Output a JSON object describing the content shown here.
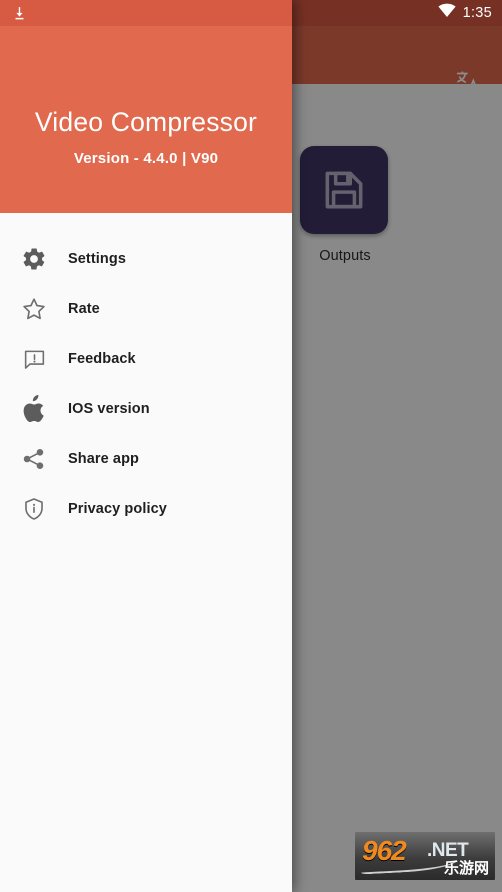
{
  "status_bar": {
    "time": "1:35",
    "download_icon": "download-icon",
    "wifi_icon": "wifi-icon"
  },
  "app": {
    "appbar": {
      "translate_icon": "translate-icon"
    },
    "tiles": [
      {
        "label": "Outputs",
        "icon": "floppy-save-icon",
        "icon_bg": "#3f3364"
      }
    ]
  },
  "drawer": {
    "header": {
      "title": "Video Compressor",
      "version": "Version - 4.4.0 | V90",
      "bg_color": "#e0694e",
      "text_color": "#ffffff"
    },
    "items": [
      {
        "label": "Settings",
        "icon": "gear-icon"
      },
      {
        "label": "Rate",
        "icon": "star-outline-icon"
      },
      {
        "label": "Feedback",
        "icon": "feedback-chat-icon"
      },
      {
        "label": "IOS version",
        "icon": "apple-icon"
      },
      {
        "label": "Share app",
        "icon": "share-icon"
      },
      {
        "label": "Privacy policy",
        "icon": "shield-info-icon"
      }
    ]
  },
  "watermark": {
    "number": "962",
    "domain": ".NET",
    "chinese": "乐游网"
  }
}
